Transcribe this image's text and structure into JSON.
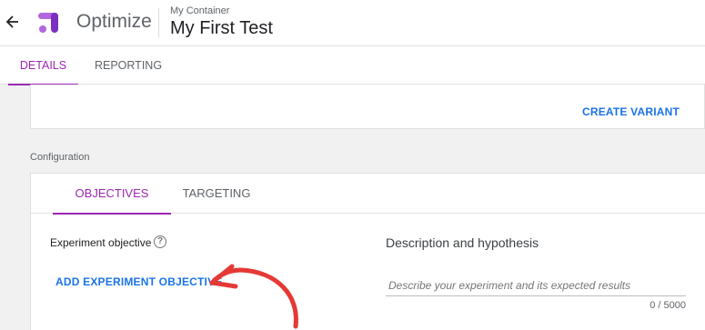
{
  "header": {
    "product": "Optimize",
    "container": "My Container",
    "experiment": "My First Test",
    "back_icon": "arrow-left-icon",
    "logo_icon": "optimize-logo-icon"
  },
  "tabs": [
    {
      "label": "DETAILS",
      "active": true
    },
    {
      "label": "REPORTING",
      "active": false
    }
  ],
  "variants": {
    "create_label": "CREATE VARIANT"
  },
  "configuration": {
    "section_label": "Configuration",
    "tabs": [
      {
        "label": "OBJECTIVES",
        "active": true
      },
      {
        "label": "TARGETING",
        "active": false
      }
    ],
    "objective": {
      "label": "Experiment objective",
      "help_icon": "help-circle-icon",
      "add_label": "ADD EXPERIMENT OBJECTIVE"
    },
    "description": {
      "title": "Description and hypothesis",
      "placeholder": "Describe your experiment and its expected results",
      "counter": "0 / 5000"
    }
  },
  "colors": {
    "accent_purple": "#9c27b0",
    "link_blue": "#1a73e8",
    "annotation_red": "#e53935",
    "logo_purple": "#b366e0",
    "logo_dark": "#7b2fbe"
  }
}
